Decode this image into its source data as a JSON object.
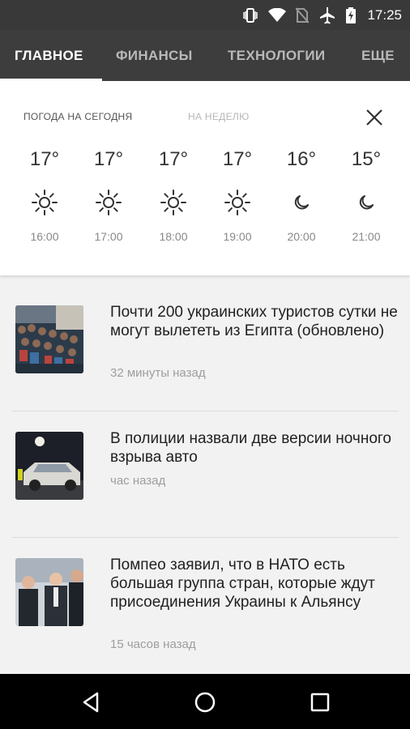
{
  "status_bar": {
    "time": "17:25",
    "icons": [
      "vibrate-icon",
      "wifi-icon",
      "no-sim-icon",
      "airplane-icon",
      "battery-charging-icon"
    ]
  },
  "tabs": [
    {
      "label": "ГЛАВНОЕ",
      "active": true
    },
    {
      "label": "ФИНАНСЫ",
      "active": false
    },
    {
      "label": "ТЕХНОЛОГИИ",
      "active": false
    },
    {
      "label": "ЕЩЕ",
      "active": false
    }
  ],
  "weather": {
    "tab_today": "ПОГОДА НА СЕГОДНЯ",
    "tab_week": "НА НЕДЕЛЮ",
    "close_icon": "close-icon",
    "forecast": [
      {
        "temp": "17°",
        "time": "16:00",
        "icon": "sun-icon"
      },
      {
        "temp": "17°",
        "time": "17:00",
        "icon": "sun-icon"
      },
      {
        "temp": "17°",
        "time": "18:00",
        "icon": "sun-icon"
      },
      {
        "temp": "17°",
        "time": "19:00",
        "icon": "sun-icon"
      },
      {
        "temp": "16°",
        "time": "20:00",
        "icon": "moon-icon"
      },
      {
        "temp": "15°",
        "time": "21:00",
        "icon": "moon-icon"
      }
    ]
  },
  "news": [
    {
      "title": "Почти 200 украинских туристов сутки не могут вылететь из Египта (обновлено)",
      "time": "32 минуты назад"
    },
    {
      "title": "В полиции назвали две версии ночного взрыва авто",
      "time": "час назад"
    },
    {
      "title": "Помпео заявил, что в НАТО есть большая группа стран, которые ждут присоединения Украины к Альянсу",
      "time": "15 часов назад"
    }
  ],
  "nav": {
    "back": "back-icon",
    "home": "home-icon",
    "recents": "recents-icon"
  }
}
